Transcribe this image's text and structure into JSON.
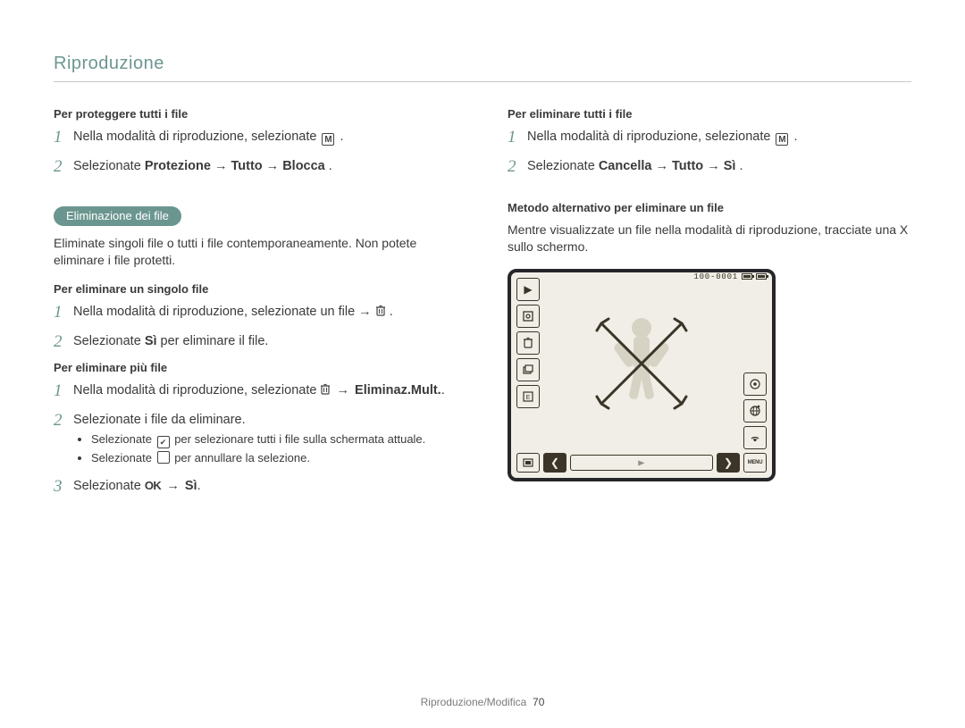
{
  "header": "Riproduzione",
  "left": {
    "protect_all_title": "Per proteggere tutti i file",
    "protect_step1": "Nella modalità di riproduzione, selezionate ",
    "protect_step1_suffix": ".",
    "protect_step2_pre": "Selezionate ",
    "protect_step2_bold": "Protezione → Tutto → Blocca",
    "protect_step2_post": ".",
    "deletion_badge": "Eliminazione dei file",
    "deletion_intro": "Eliminate singoli file o tutti i file contemporaneamente. Non potete eliminare i file protetti.",
    "del_single_title": "Per eliminare un singolo file",
    "del_single_step1_pre": "Nella modalità di riproduzione, selezionate un file → ",
    "del_single_step1_post": ".",
    "del_single_step2_pre": "Selezionate ",
    "del_single_step2_bold": "Sì",
    "del_single_step2_post": " per eliminare il file.",
    "del_multi_title": "Per eliminare più file",
    "del_multi_step1_pre": "Nella modalità di riproduzione, selezionate ",
    "del_multi_step1_mid": " → ",
    "del_multi_step1_bold": "Eliminaz.Mult.",
    "del_multi_step1_post": ".",
    "del_multi_step2": "Selezionate i file da eliminare.",
    "del_multi_b1_pre": "Selezionate ",
    "del_multi_b1_post": " per selezionare tutti i file sulla schermata attuale.",
    "del_multi_b2_pre": "Selezionate ",
    "del_multi_b2_post": " per annullare la selezione.",
    "del_multi_step3_pre": "Selezionate ",
    "del_multi_step3_ok": "OK",
    "del_multi_step3_post": " → ",
    "del_multi_step3_bold": "Sì",
    "del_multi_step3_end": "."
  },
  "right": {
    "del_all_title": "Per eliminare tutti i file",
    "del_all_step1": "Nella modalità di riproduzione, selezionate ",
    "del_all_step1_suffix": ".",
    "del_all_step2_pre": "Selezionate ",
    "del_all_step2_bold": "Cancella → Tutto → Sì",
    "del_all_step2_post": ".",
    "alt_title": "Metodo alternativo per eliminare un file",
    "alt_text": "Mentre visualizzate un file nella modalità di riproduzione, tracciate una X sullo schermo.",
    "device_counter": "100-0001",
    "menu_label": "MENU"
  },
  "footer": {
    "section": "Riproduzione/Modifica",
    "page": "70"
  }
}
